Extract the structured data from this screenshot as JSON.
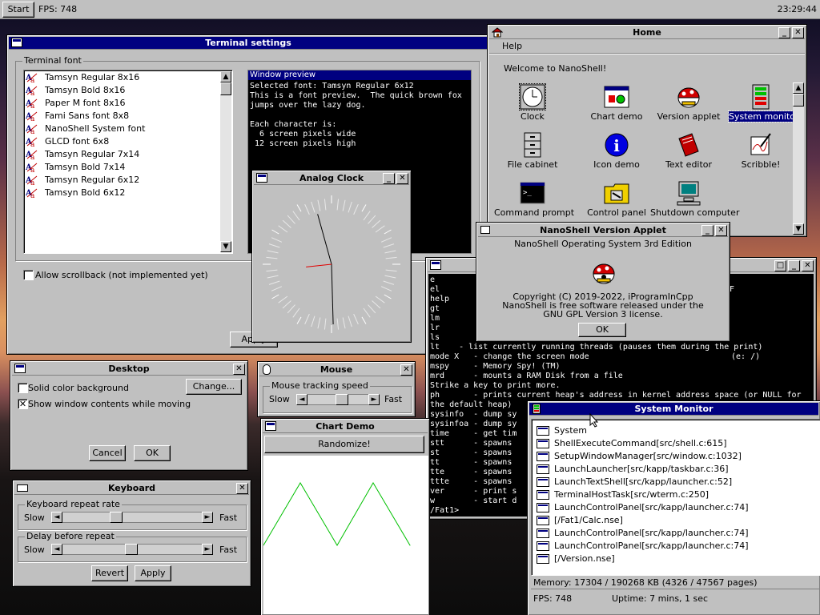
{
  "taskbar": {
    "start_label": "Start",
    "fps_label": "FPS: 748",
    "clock": "23:29:44"
  },
  "terminal_settings": {
    "title": "Terminal settings",
    "font_group_label": "Terminal font",
    "fonts": [
      "Tamsyn Regular 8x16",
      "Tamsyn Bold 8x16",
      "Paper M font 8x16",
      "Fami Sans font 8x8",
      "NanoShell System font",
      "GLCD font 6x8",
      "Tamsyn Regular 7x14",
      "Tamsyn Bold 7x14",
      "Tamsyn Regular 6x12",
      "Tamsyn Bold 6x12"
    ],
    "preview_title": "Window preview",
    "preview_text": "Selected font: Tamsyn Regular 6x12\nThis is a font preview.  The quick brown fox\njumps over the lazy dog.\n\nEach character is:\n  6 screen pixels wide\n 12 screen pixels high",
    "scrollback_label": "Allow scrollback (not implemented yet)",
    "apply_label": "Apply"
  },
  "home": {
    "title": "Home",
    "menu_help": "Help",
    "welcome": "Welcome to NanoShell!",
    "icons": [
      {
        "label": "Clock",
        "icon": "clock-icon"
      },
      {
        "label": "Chart demo",
        "icon": "chart-icon"
      },
      {
        "label": "Version applet",
        "icon": "nanoshell-logo-icon"
      },
      {
        "label": "System monitor",
        "icon": "system-monitor-icon"
      },
      {
        "label": "File cabinet",
        "icon": "file-cabinet-icon"
      },
      {
        "label": "Icon demo",
        "icon": "info-icon"
      },
      {
        "label": "Text editor",
        "icon": "text-editor-icon"
      },
      {
        "label": "Scribble!",
        "icon": "scribble-icon"
      },
      {
        "label": "Command prompt",
        "icon": "command-prompt-icon"
      },
      {
        "label": "Control panel",
        "icon": "control-panel-icon"
      },
      {
        "label": "Shutdown computer",
        "icon": "shutdown-icon"
      }
    ]
  },
  "analog_clock": {
    "title": "Analog Clock",
    "hour": 11,
    "minute": 29,
    "second": 44
  },
  "version_applet": {
    "title": "NanoShell Version Applet",
    "line1": "NanoShell Operating System 3rd Edition",
    "copyright": "Copyright (C) 2019-2022, iProgramInCpp",
    "license1": "NanoShell is free software released under the",
    "license2": "GNU GPL Version 3 license.",
    "ok_label": "OK"
  },
  "terminal": {
    "right_edge_1": "LF",
    "right_edge_2": "(e: /)",
    "lines": [
      "e",
      "el",
      "help",
      "gt",
      "lm",
      "lr",
      "ls",
      "lt    - list currently running threads (pauses them during the print)",
      "mode X   - change the screen mode",
      "mspy     - Memory Spy! (TM)",
      "mrd      - mounts a RAM Disk from a file",
      "Strike a key to print more.",
      "ph       - prints current heap's address in kernel address space (or NULL for",
      "the default heap)",
      "sysinfo  - dump sy",
      "sysinfoa - dump sy",
      "time     - get tim",
      "stt      - spawns",
      "st       - spawns",
      "tt       - spawns",
      "tte      - spawns",
      "ttte     - spawns",
      "ver      - print s",
      "w        - start d",
      "/Fat1>"
    ]
  },
  "desktop": {
    "title": "Desktop",
    "solid_label": "Solid color background",
    "change_label": "Change...",
    "show_contents_label": "Show window contents while moving",
    "show_contents_checked": true,
    "cancel_label": "Cancel",
    "ok_label": "OK"
  },
  "mouse": {
    "title": "Mouse",
    "group_label": "Mouse tracking speed",
    "slow": "Slow",
    "fast": "Fast",
    "speed": 0.6
  },
  "keyboard": {
    "title": "Keyboard",
    "repeat_group": "Keyboard repeat rate",
    "delay_group": "Delay before repeat",
    "slow": "Slow",
    "fast": "Fast",
    "repeat_rate": 0.38,
    "delay": 0.5,
    "revert_label": "Revert",
    "apply_label": "Apply"
  },
  "chart_demo": {
    "title": "Chart Demo",
    "randomize_label": "Randomize!"
  },
  "chart_data": {
    "type": "line",
    "values": [
      100,
      190,
      100,
      190,
      100
    ],
    "ylim": [
      0,
      230
    ],
    "color": "#00c000"
  },
  "system_monitor": {
    "title": "System Monitor",
    "processes": [
      "System",
      "ShellExecuteCommand[src/shell.c:615]",
      "SetupWindowManager[src/window.c:1032]",
      "LaunchLauncher[src/kapp/taskbar.c:36]",
      "LaunchTextShell[src/kapp/launcher.c:52]",
      "TerminalHostTask[src/wterm.c:250]",
      "LaunchControlPanel[src/kapp/launcher.c:74]",
      "[/Fat1/Calc.nse]",
      "LaunchControlPanel[src/kapp/launcher.c:74]",
      "LaunchControlPanel[src/kapp/launcher.c:74]",
      "[/Version.nse]"
    ],
    "memory": "Memory: 17304 / 190268 KB (4326 / 47567 pages)",
    "fps": "FPS: 748",
    "uptime": "Uptime: 7 mins, 1 sec"
  }
}
